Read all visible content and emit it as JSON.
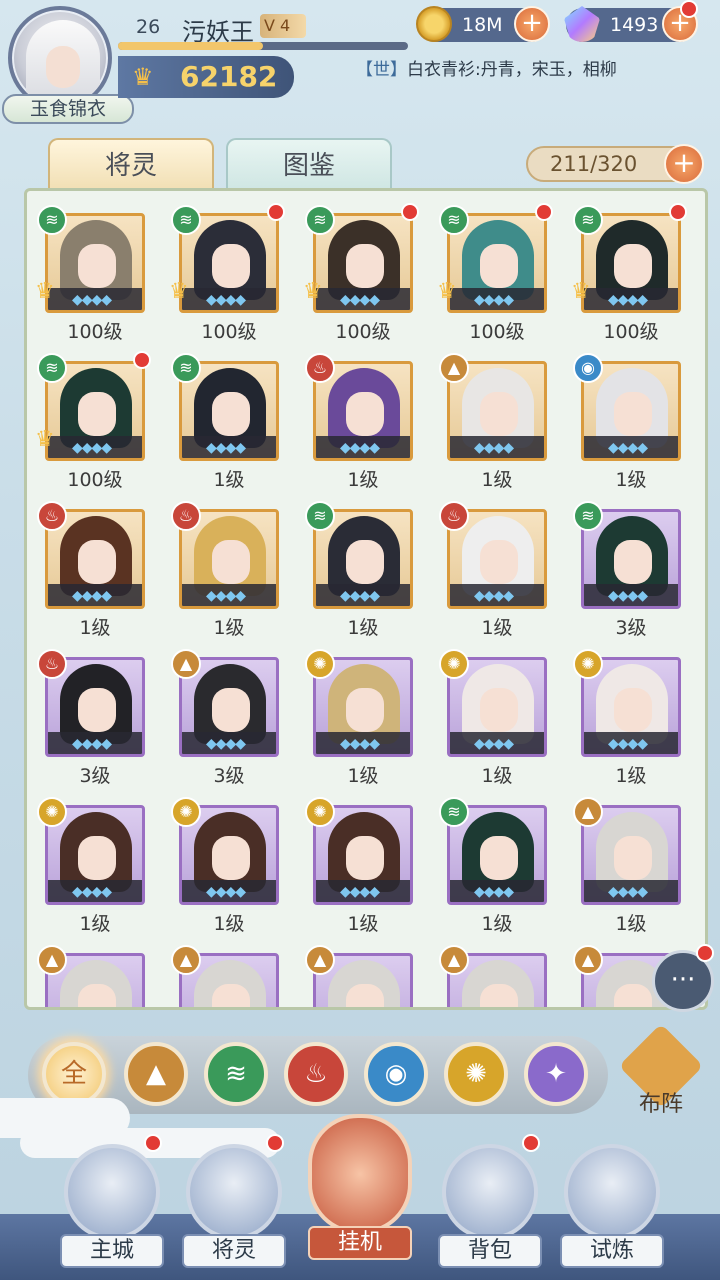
{
  "player": {
    "level": "26",
    "name": "污妖王",
    "vip": "V 4",
    "title": "玉食锦衣",
    "power": "62182",
    "exp_fraction": 0.5
  },
  "resources": {
    "gold": "18M",
    "gem": "1493"
  },
  "chat_ticker": {
    "channel": "【世】",
    "message": "白衣青衫:丹青，宋玉，相柳"
  },
  "tabs": {
    "spirits": "将灵",
    "codex": "图鉴"
  },
  "capacity": "211/320",
  "cards": [
    {
      "level": "100级",
      "element": "wind",
      "rarity": "gold",
      "dot": false,
      "crown": true,
      "hair": "#8a7f6d"
    },
    {
      "level": "100级",
      "element": "wind",
      "rarity": "gold",
      "dot": true,
      "crown": true,
      "hair": "#2b2d38"
    },
    {
      "level": "100级",
      "element": "wind",
      "rarity": "gold",
      "dot": true,
      "crown": true,
      "hair": "#3b3028"
    },
    {
      "level": "100级",
      "element": "wind",
      "rarity": "gold",
      "dot": true,
      "crown": true,
      "hair": "#3f8c8a"
    },
    {
      "level": "100级",
      "element": "wind",
      "rarity": "gold",
      "dot": true,
      "crown": true,
      "hair": "#1f2a2a"
    },
    {
      "level": "100级",
      "element": "wind",
      "rarity": "gold",
      "dot": true,
      "crown": true,
      "hair": "#1d3a33"
    },
    {
      "level": "1级",
      "element": "wind",
      "rarity": "gold",
      "dot": false,
      "crown": false,
      "hair": "#222630"
    },
    {
      "level": "1级",
      "element": "fire",
      "rarity": "gold",
      "dot": false,
      "crown": false,
      "hair": "#6a4a9a"
    },
    {
      "level": "1级",
      "element": "earth",
      "rarity": "gold",
      "dot": false,
      "crown": false,
      "hair": "#e8e6e4"
    },
    {
      "level": "1级",
      "element": "water",
      "rarity": "gold",
      "dot": false,
      "crown": false,
      "hair": "#e3e3e6"
    },
    {
      "level": "1级",
      "element": "fire",
      "rarity": "gold",
      "dot": false,
      "crown": false,
      "hair": "#5a3322"
    },
    {
      "level": "1级",
      "element": "fire",
      "rarity": "gold",
      "dot": false,
      "crown": false,
      "hair": "#d9b15a"
    },
    {
      "level": "1级",
      "element": "wind",
      "rarity": "gold",
      "dot": false,
      "crown": false,
      "hair": "#2a2c36"
    },
    {
      "level": "1级",
      "element": "fire",
      "rarity": "gold",
      "dot": false,
      "crown": false,
      "hair": "#eeeeee"
    },
    {
      "level": "3级",
      "element": "wind",
      "rarity": "purple",
      "dot": false,
      "crown": false,
      "hair": "#1d3a33"
    },
    {
      "level": "3级",
      "element": "fire",
      "rarity": "purple",
      "dot": false,
      "crown": false,
      "hair": "#222226"
    },
    {
      "level": "3级",
      "element": "earth",
      "rarity": "purple",
      "dot": false,
      "crown": false,
      "hair": "#2a2a2e"
    },
    {
      "level": "1级",
      "element": "light",
      "rarity": "purple",
      "dot": false,
      "crown": false,
      "hair": "#cfb47a"
    },
    {
      "level": "1级",
      "element": "light",
      "rarity": "purple",
      "dot": false,
      "crown": false,
      "hair": "#efe8e6"
    },
    {
      "level": "1级",
      "element": "light",
      "rarity": "purple",
      "dot": false,
      "crown": false,
      "hair": "#efe8e6"
    },
    {
      "level": "1级",
      "element": "light",
      "rarity": "purple",
      "dot": false,
      "crown": false,
      "hair": "#4a2e26"
    },
    {
      "level": "1级",
      "element": "light",
      "rarity": "purple",
      "dot": false,
      "crown": false,
      "hair": "#4a2e26"
    },
    {
      "level": "1级",
      "element": "light",
      "rarity": "purple",
      "dot": false,
      "crown": false,
      "hair": "#4a2e26"
    },
    {
      "level": "1级",
      "element": "wind",
      "rarity": "purple",
      "dot": false,
      "crown": false,
      "hair": "#1d3a33"
    },
    {
      "level": "1级",
      "element": "earth",
      "rarity": "purple",
      "dot": false,
      "crown": false,
      "hair": "#d8d6d2"
    },
    {
      "level": "",
      "element": "earth",
      "rarity": "purple",
      "dot": false,
      "crown": false,
      "hair": "#d8d6d2"
    },
    {
      "level": "",
      "element": "earth",
      "rarity": "purple",
      "dot": false,
      "crown": false,
      "hair": "#d8d6d2"
    },
    {
      "level": "",
      "element": "earth",
      "rarity": "purple",
      "dot": false,
      "crown": false,
      "hair": "#d8d6d2"
    },
    {
      "level": "",
      "element": "earth",
      "rarity": "purple",
      "dot": false,
      "crown": false,
      "hair": "#d8d6d2"
    },
    {
      "level": "",
      "element": "earth",
      "rarity": "purple",
      "dot": false,
      "crown": false,
      "hair": "#d8d6d2"
    }
  ],
  "element_icons": {
    "wind": "≋",
    "fire": "♨",
    "earth": "▲",
    "water": "◉",
    "light": "✺"
  },
  "filters": {
    "all": "全",
    "earth": "▲",
    "wind": "≋",
    "fire": "♨",
    "water": "◉",
    "light": "✺",
    "shadow": "✦"
  },
  "formation_label": "布阵",
  "chat_button": "···",
  "bottom_nav": {
    "main_city": "主城",
    "spirits": "将灵",
    "idle": "挂机",
    "bag": "背包",
    "trial": "试炼"
  }
}
